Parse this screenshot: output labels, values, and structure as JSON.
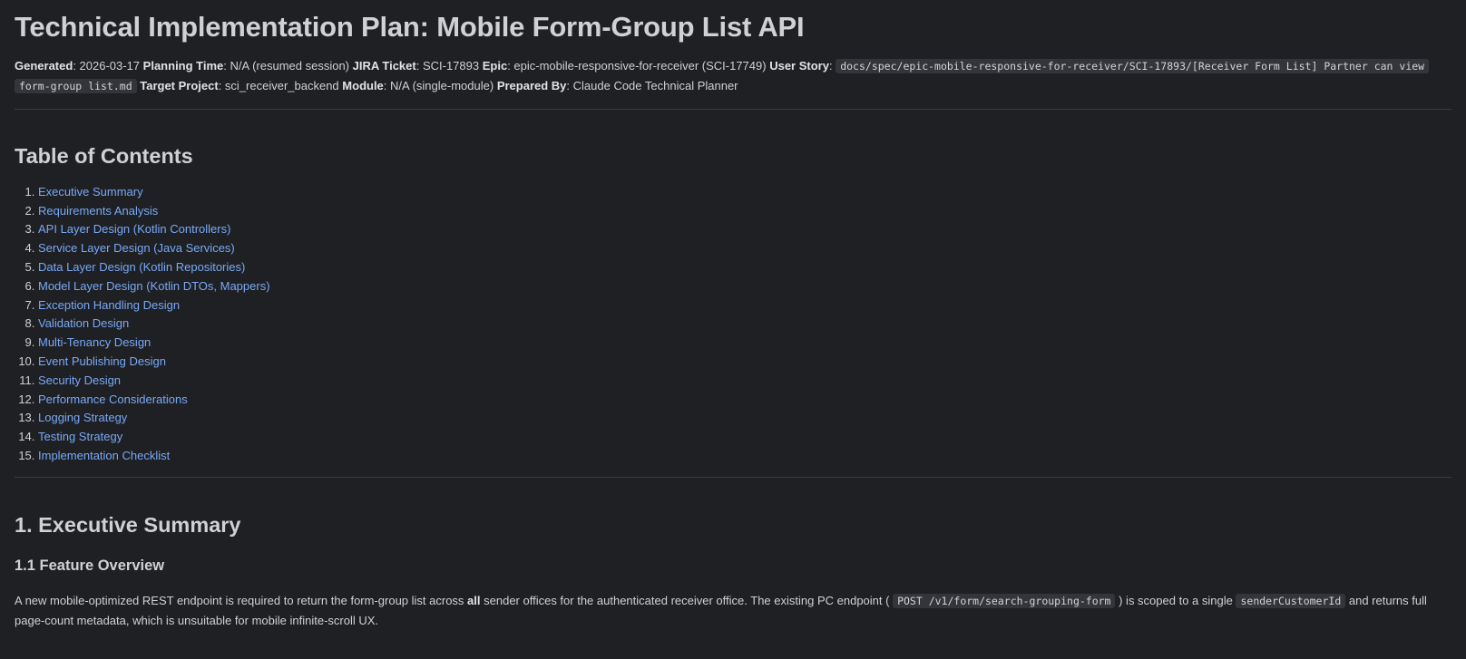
{
  "title": "Technical Implementation Plan: Mobile Form-Group List API",
  "meta": {
    "generated_label": "Generated",
    "generated_value": ": 2026-03-17",
    "planning_label": "Planning Time",
    "planning_value": ": N/A (resumed session)",
    "jira_label": "JIRA Ticket",
    "jira_value": ": SCI-17893",
    "epic_label": "Epic",
    "epic_value": ": epic-mobile-responsive-for-receiver (SCI-17749)",
    "story_label": "User Story",
    "story_sep": ":",
    "story_path_1": "docs/spec/epic-mobile-responsive-for-receiver/SCI-17893/[Receiver Form List] Partner can view",
    "story_path_2": "form-group list.md",
    "project_label": "Target Project",
    "project_value": ": sci_receiver_backend",
    "module_label": "Module",
    "module_value": ": N/A (single-module)",
    "prepared_label": "Prepared By",
    "prepared_value": ": Claude Code Technical Planner"
  },
  "toc": {
    "heading": "Table of Contents",
    "items": [
      {
        "num": "1.",
        "label": "Executive Summary"
      },
      {
        "num": "2.",
        "label": "Requirements Analysis"
      },
      {
        "num": "3.",
        "label": "API Layer Design (Kotlin Controllers)"
      },
      {
        "num": "4.",
        "label": "Service Layer Design (Java Services)"
      },
      {
        "num": "5.",
        "label": "Data Layer Design (Kotlin Repositories)"
      },
      {
        "num": "6.",
        "label": "Model Layer Design (Kotlin DTOs, Mappers)"
      },
      {
        "num": "7.",
        "label": "Exception Handling Design"
      },
      {
        "num": "8.",
        "label": "Validation Design"
      },
      {
        "num": "9.",
        "label": "Multi-Tenancy Design"
      },
      {
        "num": "10.",
        "label": "Event Publishing Design"
      },
      {
        "num": "11.",
        "label": "Security Design"
      },
      {
        "num": "12.",
        "label": "Performance Considerations"
      },
      {
        "num": "13.",
        "label": "Logging Strategy"
      },
      {
        "num": "14.",
        "label": "Testing Strategy"
      },
      {
        "num": "15.",
        "label": "Implementation Checklist"
      }
    ]
  },
  "executive": {
    "heading": "1. Executive Summary",
    "subheading": "1.1 Feature Overview",
    "p1": "A new mobile-optimized REST endpoint is required to return the form-group list across ",
    "p_bold": "all",
    "p2": " sender offices for the authenticated receiver office. The existing PC endpoint (",
    "code1": "POST /v1/form/search-grouping-form",
    "p3": ") is scoped to a single ",
    "code2": "senderCustomerId",
    "p4": " and returns full page-count metadata, which is unsuitable for mobile infinite-scroll UX."
  }
}
